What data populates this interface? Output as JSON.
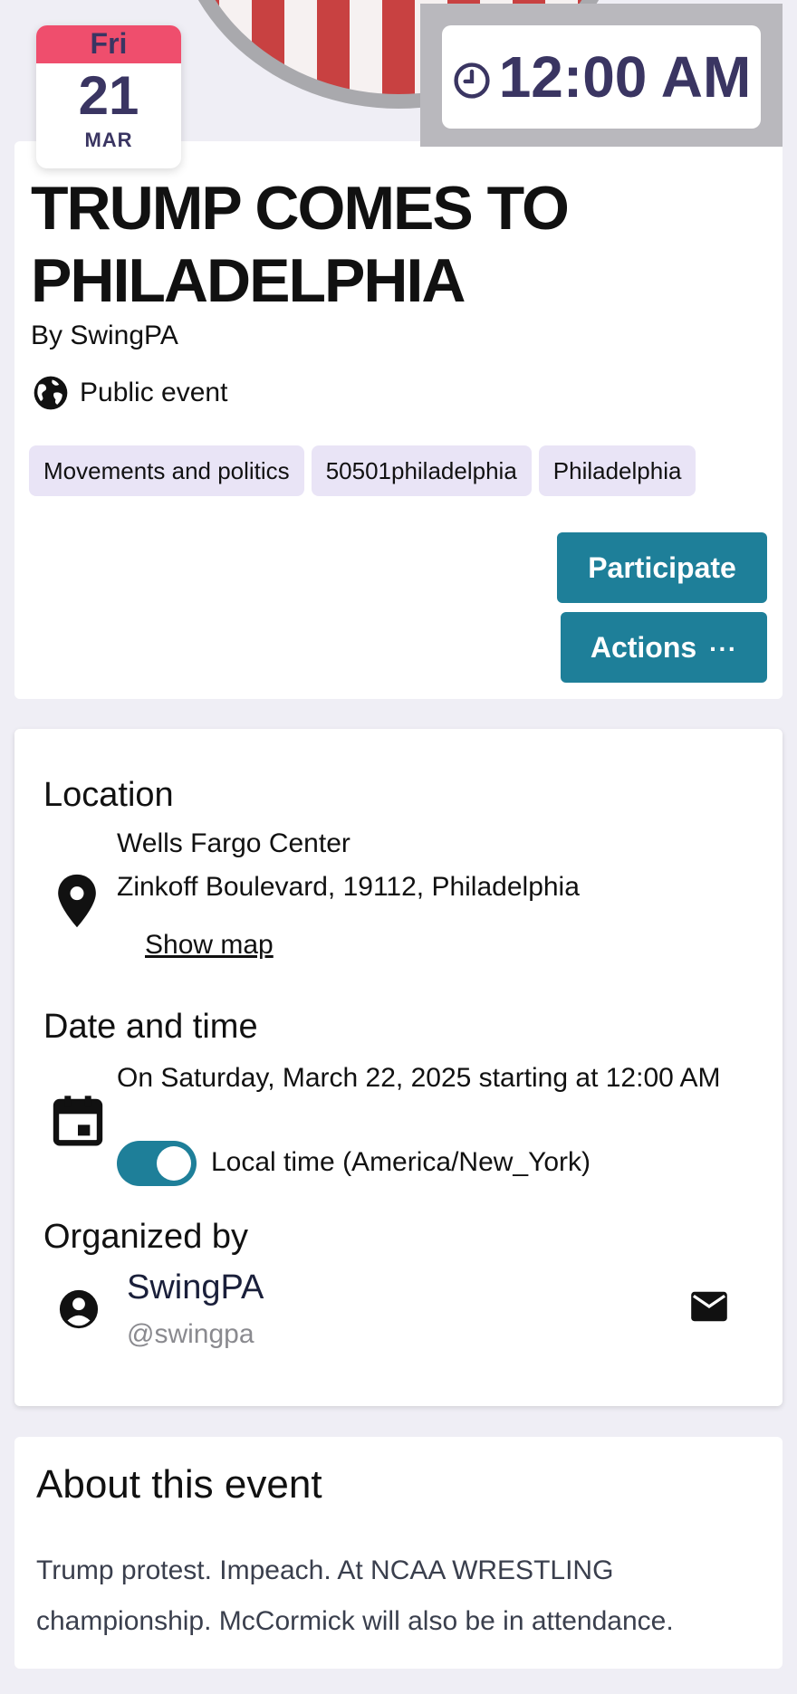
{
  "colors": {
    "accent": "#1e7f99",
    "date_header": "#ef4e6d",
    "date_text": "#3a3562",
    "tag_bg": "#e9e4f6",
    "page_bg": "#efeef5"
  },
  "date_badge": {
    "weekday": "Fri",
    "day": "21",
    "month": "MAR"
  },
  "time_badge": {
    "icon": "clock-icon",
    "time": "12:00 AM"
  },
  "event": {
    "title": "TRUMP COMES TO PHILADELPHIA",
    "byline": "By SwingPA",
    "visibility_icon": "globe-icon",
    "visibility": "Public event",
    "tags": [
      "Movements and politics",
      "50501philadelphia",
      "Philadelphia"
    ]
  },
  "buttons": {
    "participate": "Participate",
    "actions": "Actions",
    "actions_icon": "···"
  },
  "location": {
    "title": "Location",
    "icon": "map-pin-icon",
    "venue": "Wells Fargo Center",
    "address": "Zinkoff Boulevard, 19112, Philadelphia",
    "show_map": "Show map"
  },
  "datetime": {
    "title": "Date and time",
    "icon": "calendar-icon",
    "text": "On Saturday, March 22, 2025 starting at 12:00 AM",
    "local_time_enabled": true,
    "timezone_label": "Local time (America/New_York)"
  },
  "organizer": {
    "title": "Organized by",
    "icon": "user-circle-icon",
    "name": "SwingPA",
    "handle": "@swingpa",
    "contact_icon": "mail-icon"
  },
  "about": {
    "title": "About this event",
    "text": "Trump protest. Impeach. At NCAA WRESTLING championship. McCormick will also be in attendance."
  }
}
